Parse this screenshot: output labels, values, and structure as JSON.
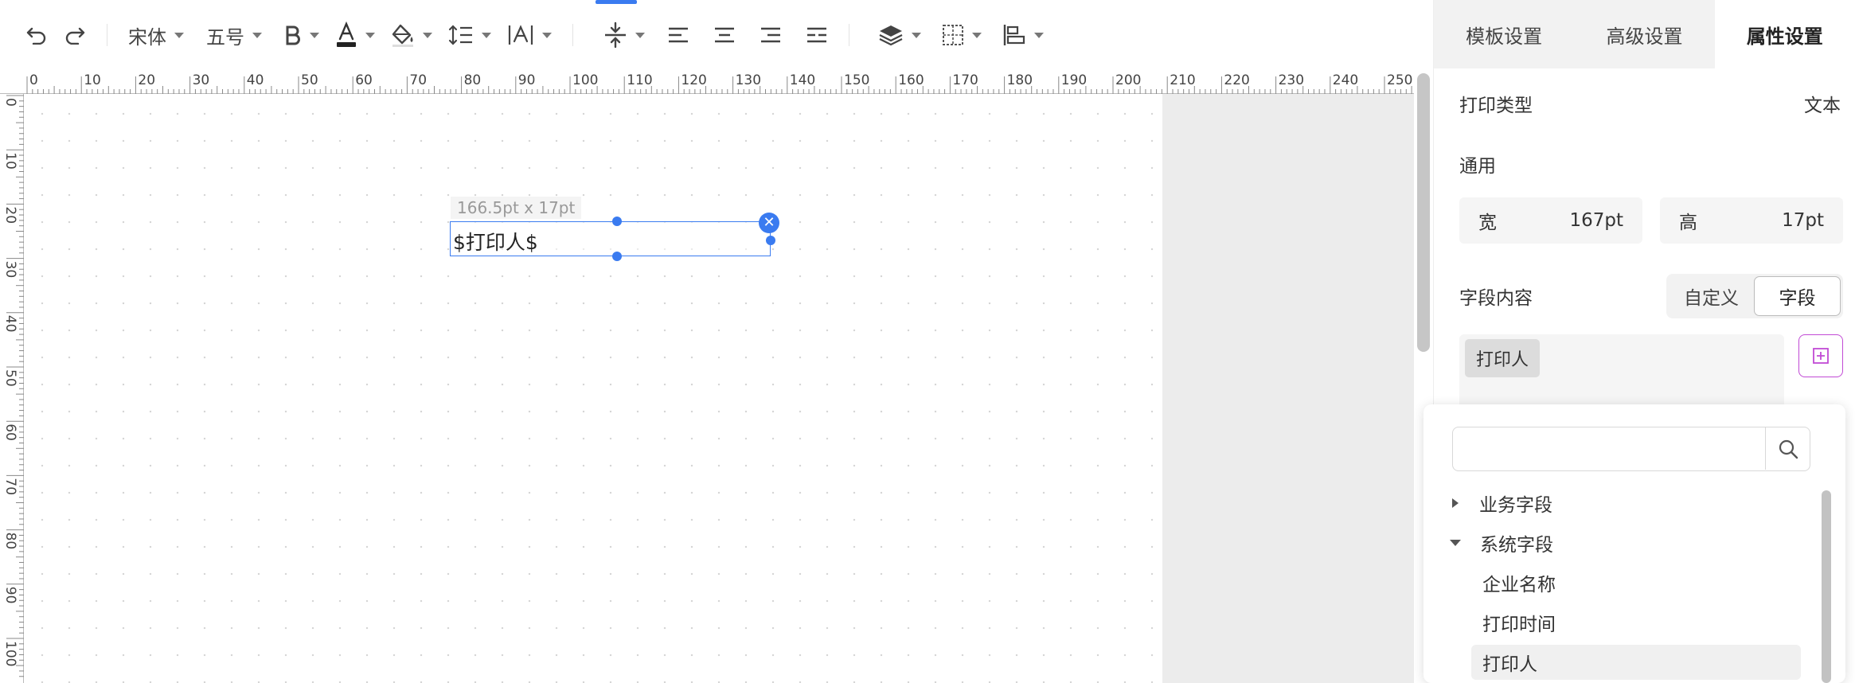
{
  "toolbar": {
    "font_family": "宋体",
    "font_size": "五号"
  },
  "ruler": {
    "h_labels": [
      "0",
      "10",
      "20",
      "30",
      "40",
      "50",
      "60",
      "70",
      "80",
      "90",
      "100",
      "110",
      "120",
      "130",
      "140",
      "150",
      "160",
      "170",
      "180",
      "190",
      "200",
      "210",
      "220",
      "230",
      "240",
      "250"
    ],
    "v_labels": [
      "0",
      "10",
      "20",
      "30",
      "40",
      "50",
      "60",
      "70",
      "80",
      "90",
      "100"
    ]
  },
  "element": {
    "size_label": "166.5pt x 17pt",
    "text": "$打印人$"
  },
  "panel": {
    "tabs": [
      "模板设置",
      "高级设置",
      "属性设置"
    ],
    "active_tab": "属性设置",
    "print_type_label": "打印类型",
    "print_type_value": "文本",
    "general_label": "通用",
    "width_label": "宽",
    "width_value": "167pt",
    "height_label": "高",
    "height_value": "17pt",
    "field_content_label": "字段内容",
    "segment": [
      "自定义",
      "字段"
    ],
    "selected_tag": "打印人"
  },
  "dropdown": {
    "search_placeholder": "",
    "groups": [
      {
        "label": "业务字段",
        "expanded": false
      },
      {
        "label": "系统字段",
        "expanded": true
      }
    ],
    "system_fields": [
      "企业名称",
      "打印时间",
      "打印人"
    ],
    "highlighted": "打印人"
  },
  "colors": {
    "accent": "#3a7bf0",
    "add_button": "#c14ad5"
  }
}
